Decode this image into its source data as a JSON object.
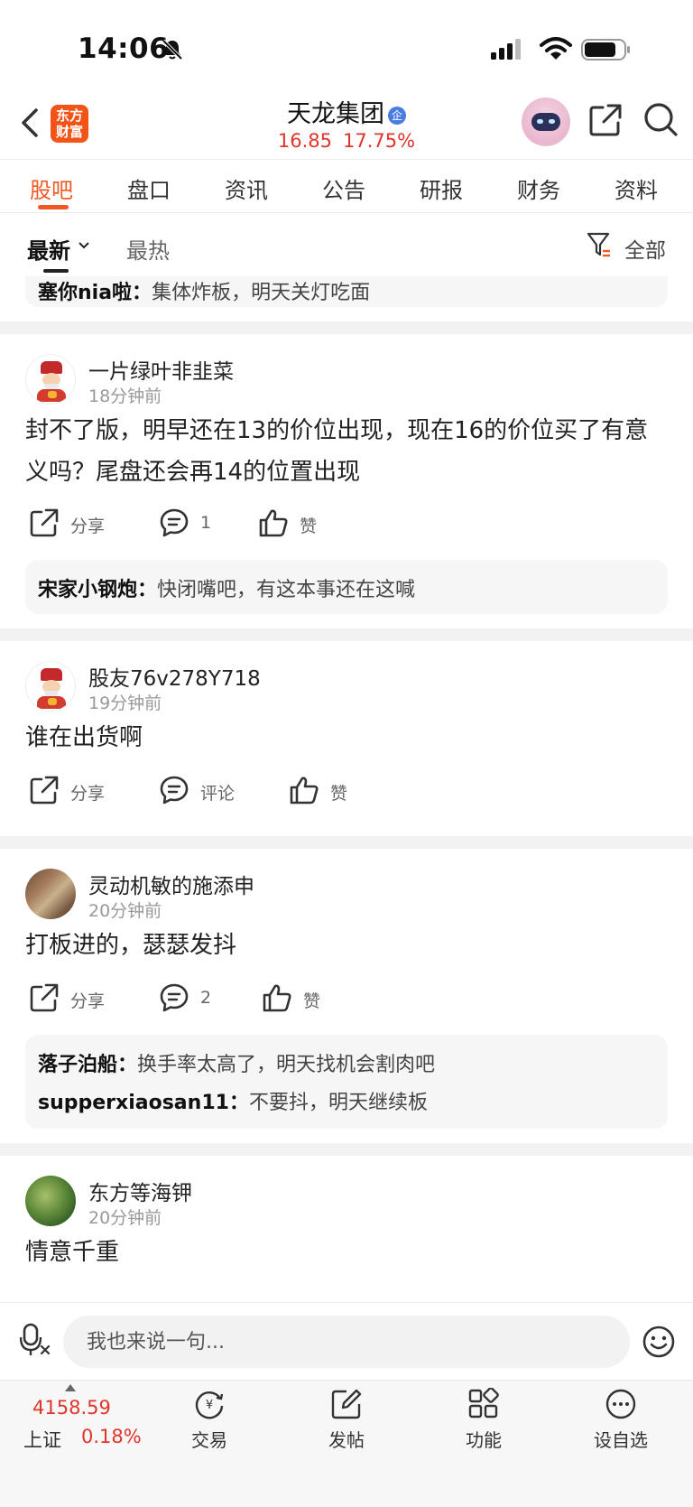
{
  "status_bar": {
    "time": "14:06"
  },
  "header": {
    "logo_text_line1": "东方",
    "logo_text_line2": "财富",
    "stock_name": "天龙集团",
    "enterprise_badge": "企",
    "price": "16.85",
    "change_pct": "17.75%"
  },
  "tabs": [
    "股吧",
    "盘口",
    "资讯",
    "公告",
    "研报",
    "财务",
    "资料"
  ],
  "sort": {
    "latest": "最新",
    "hot": "最热",
    "filter_label": "全部"
  },
  "feed": {
    "top_reply": {
      "name": "塞你nia啦：",
      "text": "集体炸板，明天关灯吃面"
    },
    "posts": [
      {
        "username": "一片绿叶非韭菜",
        "time": "18分钟前",
        "text": "封不了版，明早还在13的价位出现，现在16的价位买了有意义吗？尾盘还会再14的位置出现",
        "share_label": "分享",
        "comment_label": "1",
        "like_label": "赞",
        "replies": [
          {
            "name": "宋家小钢炮：",
            "text": "快闭嘴吧，有这本事还在这喊"
          }
        ]
      },
      {
        "username": "股友76v278Y718",
        "time": "19分钟前",
        "text": "谁在出货啊",
        "share_label": "分享",
        "comment_label": "评论",
        "like_label": "赞",
        "replies": []
      },
      {
        "username": "灵动机敏的施添申",
        "time": "20分钟前",
        "text": "打板进的，瑟瑟发抖",
        "share_label": "分享",
        "comment_label": "2",
        "like_label": "赞",
        "replies": [
          {
            "name": "落子泊船：",
            "text": "换手率太高了，明天找机会割肉吧"
          },
          {
            "name": "supperxiaosan11：",
            "text": "不要抖，明天继续板"
          }
        ]
      },
      {
        "username": "东方等海钾",
        "time": "20分钟前",
        "text": "情意千重"
      }
    ]
  },
  "comment_bar": {
    "placeholder": "我也来说一句..."
  },
  "bottom_bar": {
    "index_value": "4158.59",
    "index_name": "上证",
    "index_change": "0.18%",
    "items": [
      "交易",
      "发帖",
      "功能",
      "设自选"
    ]
  },
  "colors": {
    "accent": "#ef5a24",
    "up_red": "#e0352b",
    "badge_blue": "#4a7de2"
  },
  "icons": [
    "back-icon",
    "search-icon",
    "share-icon",
    "filter-icon",
    "comment-icon",
    "like-icon",
    "voice-icon",
    "emoji-icon",
    "trade-icon",
    "compose-icon",
    "grid-icon",
    "more-icon"
  ]
}
